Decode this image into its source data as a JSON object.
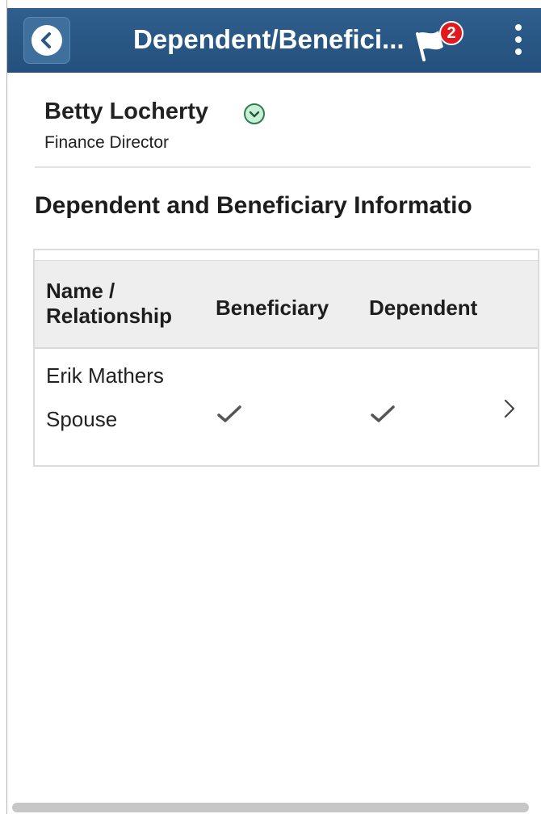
{
  "header": {
    "title": "Dependent/Benefici...",
    "notification_count": "2",
    "back_icon": "chevron-left-icon",
    "flag_icon": "flag-icon",
    "menu_icon": "kebab-menu-icon",
    "bar_color": "#2a5885"
  },
  "person": {
    "name": "Betty Locherty",
    "title": "Finance Director",
    "related_icon": "chevron-down-circle-icon"
  },
  "section": {
    "title": "Dependent and Beneficiary Informatio"
  },
  "table": {
    "columns": {
      "name_line1": "Name /",
      "name_line2": "Relationship",
      "beneficiary": "Beneficiary",
      "dependent": "Dependent"
    },
    "rows": [
      {
        "name": "Erik Mathers",
        "relationship": "Spouse",
        "beneficiary": true,
        "dependent": true
      }
    ]
  }
}
